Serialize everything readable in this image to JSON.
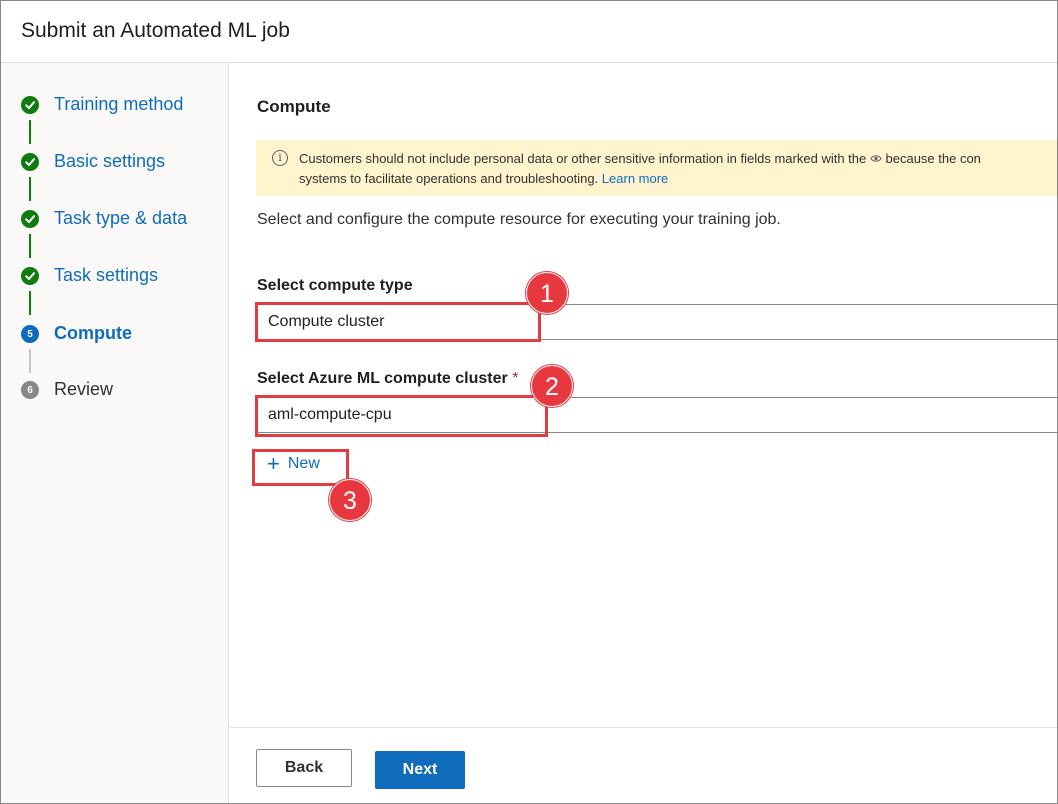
{
  "dialog": {
    "title": "Submit an Automated ML job"
  },
  "steps": [
    {
      "label": "Training method",
      "state": "done"
    },
    {
      "label": "Basic settings",
      "state": "done"
    },
    {
      "label": "Task type & data",
      "state": "done"
    },
    {
      "label": "Task settings",
      "state": "done"
    },
    {
      "label": "Compute",
      "state": "current",
      "number": "5"
    },
    {
      "label": "Review",
      "state": "pending",
      "number": "6"
    }
  ],
  "main": {
    "section_title": "Compute",
    "info": {
      "line1": "Customers should not include personal data or other sensitive information in fields marked with the",
      "line1_tail": "because the con",
      "line2": "systems to facilitate operations and troubleshooting.",
      "link": "Learn more"
    },
    "description": "Select and configure the compute resource for executing your training job.",
    "compute_type": {
      "label": "Select compute type",
      "value": "Compute cluster"
    },
    "compute_cluster": {
      "label": "Select Azure ML compute cluster",
      "required_mark": "*",
      "value": "aml-compute-cpu"
    },
    "new_button": {
      "icon": "plus-icon",
      "label": "New"
    }
  },
  "callouts": [
    "1",
    "2",
    "3"
  ],
  "footer": {
    "back_label": "Back",
    "next_label": "Next"
  },
  "colors": {
    "accent": "#0f6cbd",
    "success": "#107c10",
    "callout": "#e8383f",
    "info_bg": "#fff4ce"
  }
}
